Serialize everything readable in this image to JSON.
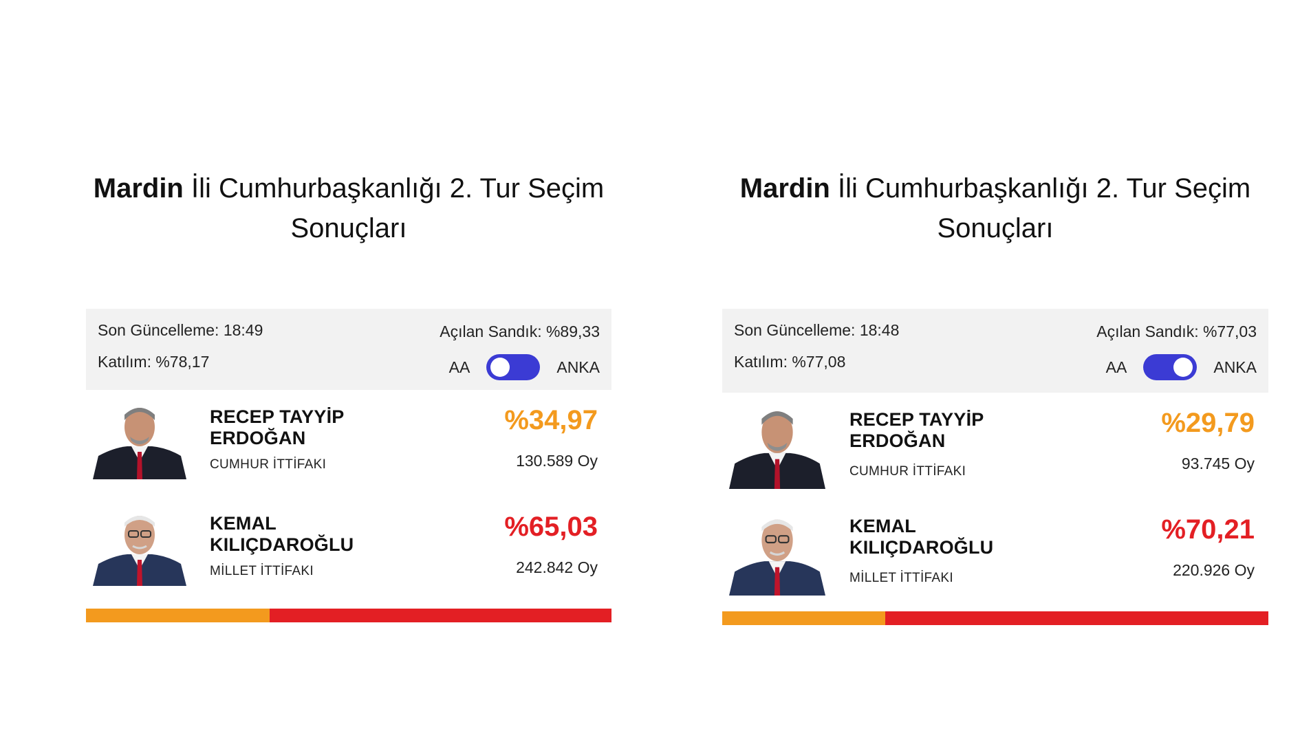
{
  "colors": {
    "erdogan": "#f39a1e",
    "kilicdaroglu": "#e31f24",
    "toggle": "#3b3bd4",
    "info_bg": "#f2f2f2"
  },
  "panels": [
    {
      "title_city": "Mardin",
      "title_rest": "İli Cumhurbaşkanlığı 2. Tur Seçim Sonuçları",
      "last_update": "Son Güncelleme: 18:49",
      "turnout": "Katılım: %78,17",
      "ballot_opened": "Açılan Sandık: %89,33",
      "toggle_left": "AA",
      "toggle_right": "ANKA",
      "toggle_on": false,
      "candidates": [
        {
          "name_line1": "RECEP TAYYİP",
          "name_line2": "ERDOĞAN",
          "alliance": "CUMHUR İTTİFAKI",
          "percent": "%34,97",
          "votes": "130.589 Oy",
          "share": 34.97
        },
        {
          "name_line1": "KEMAL",
          "name_line2": "KILIÇDAROĞLU",
          "alliance": "MİLLET İTTİFAKI",
          "percent": "%65,03",
          "votes": "242.842 Oy",
          "share": 65.03
        }
      ]
    },
    {
      "title_city": "Mardin",
      "title_rest": "İli Cumhurbaşkanlığı 2. Tur Seçim Sonuçları",
      "last_update": "Son Güncelleme: 18:48",
      "turnout": "Katılım: %77,08",
      "ballot_opened": "Açılan Sandık: %77,03",
      "toggle_left": "AA",
      "toggle_right": "ANKA",
      "toggle_on": true,
      "candidates": [
        {
          "name_line1": "RECEP TAYYİP",
          "name_line2": "ERDOĞAN",
          "alliance": "CUMHUR İTTİFAKI",
          "percent": "%29,79",
          "votes": "93.745 Oy",
          "share": 29.79
        },
        {
          "name_line1": "KEMAL",
          "name_line2": "KILIÇDAROĞLU",
          "alliance": "MİLLET İTTİFAKI",
          "percent": "%70,21",
          "votes": "220.926 Oy",
          "share": 70.21
        }
      ]
    }
  ]
}
